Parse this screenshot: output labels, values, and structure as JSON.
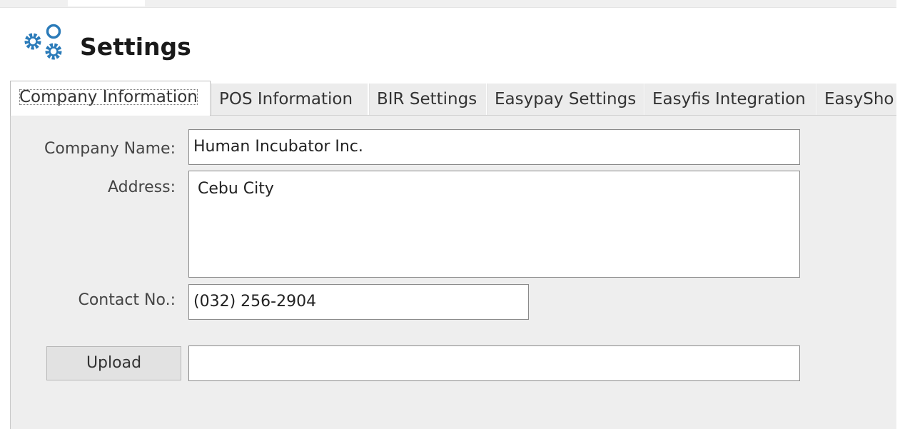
{
  "header": {
    "title": "Settings",
    "icon": "gears-icon"
  },
  "tabs": [
    {
      "label": "Company Information",
      "active": true
    },
    {
      "label": "POS Information",
      "active": false
    },
    {
      "label": "BIR Settings",
      "active": false
    },
    {
      "label": "Easypay Settings",
      "active": false
    },
    {
      "label": "Easyfis Integration",
      "active": false
    },
    {
      "label": "EasySho",
      "active": false
    }
  ],
  "form": {
    "company_name": {
      "label": "Company Name:",
      "value": "Human Incubator Inc."
    },
    "address": {
      "label": "Address:",
      "value": "Cebu City"
    },
    "contact": {
      "label": "Contact No.:",
      "value": "(032) 256-2904"
    },
    "upload": {
      "button_label": "Upload",
      "value": ""
    }
  },
  "colors": {
    "accent": "#2b7bb9",
    "panel_bg": "#eeeeee",
    "border": "#8a8a8a"
  }
}
